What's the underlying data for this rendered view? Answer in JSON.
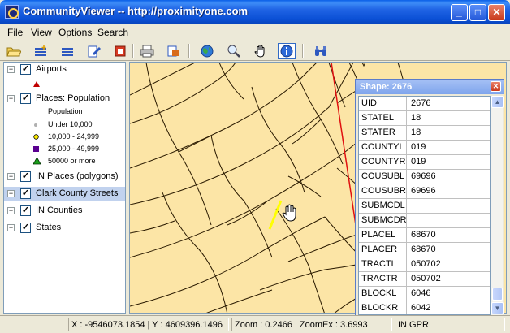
{
  "window": {
    "title": "CommunityViewer -- http://proximityone.com"
  },
  "menu": [
    "File",
    "View",
    "Options",
    "Search"
  ],
  "toolbar": {
    "buttons": [
      "open-icon",
      "layers-add-icon",
      "layers-list-icon",
      "edit-icon",
      "stop-icon",
      "print-icon",
      "export-icon",
      "globe-icon",
      "zoom-icon",
      "pan-hand-icon",
      "info-icon",
      "find-binoculars-icon"
    ]
  },
  "legend": {
    "layers": [
      {
        "label": "Airports",
        "checked": "✓",
        "expander": "−"
      },
      {
        "label": "Places: Population",
        "checked": "✓",
        "expander": "−"
      },
      {
        "label": "IN Places (polygons)",
        "checked": "✓",
        "expander": "−"
      },
      {
        "label": "Clark County Streets",
        "checked": "✓",
        "expander": "−"
      },
      {
        "label": "IN Counties",
        "checked": "✓",
        "expander": "−"
      },
      {
        "label": "States",
        "checked": "✓",
        "expander": "−"
      }
    ],
    "population_classes": {
      "heading": "Population",
      "items": [
        "Under 10,000",
        "10,000 - 24,999",
        "25,000 - 49,999",
        "50000 or more"
      ]
    }
  },
  "shape_window": {
    "title": "Shape: 2676",
    "close": "✕",
    "rows": [
      {
        "key": "UID",
        "value": "2676"
      },
      {
        "key": "STATEL",
        "value": "18"
      },
      {
        "key": "STATER",
        "value": "18"
      },
      {
        "key": "COUNTYL",
        "value": "019"
      },
      {
        "key": "COUNTYR",
        "value": "019"
      },
      {
        "key": "COUSUBL",
        "value": "69696"
      },
      {
        "key": "COUSUBR",
        "value": "69696"
      },
      {
        "key": "SUBMCDL",
        "value": ""
      },
      {
        "key": "SUBMCDR",
        "value": ""
      },
      {
        "key": "PLACEL",
        "value": "68670"
      },
      {
        "key": "PLACER",
        "value": "68670"
      },
      {
        "key": "TRACTL",
        "value": "050702"
      },
      {
        "key": "TRACTR",
        "value": "050702"
      },
      {
        "key": "BLOCKL",
        "value": "6046"
      },
      {
        "key": "BLOCKR",
        "value": "6042"
      }
    ],
    "scroll_up": "▲",
    "scroll_down": "▼"
  },
  "status": {
    "coords": "X : -9546073.1854 | Y : 4609396.1496",
    "zoom": "Zoom : 0.2466 | ZoomEx : 3.6993",
    "file": "IN.GPR"
  },
  "colors": {
    "map_fill": "#fce5a6",
    "street": "#2a1a00",
    "selected_street": "#ffff00",
    "boundary": "#e01010"
  }
}
